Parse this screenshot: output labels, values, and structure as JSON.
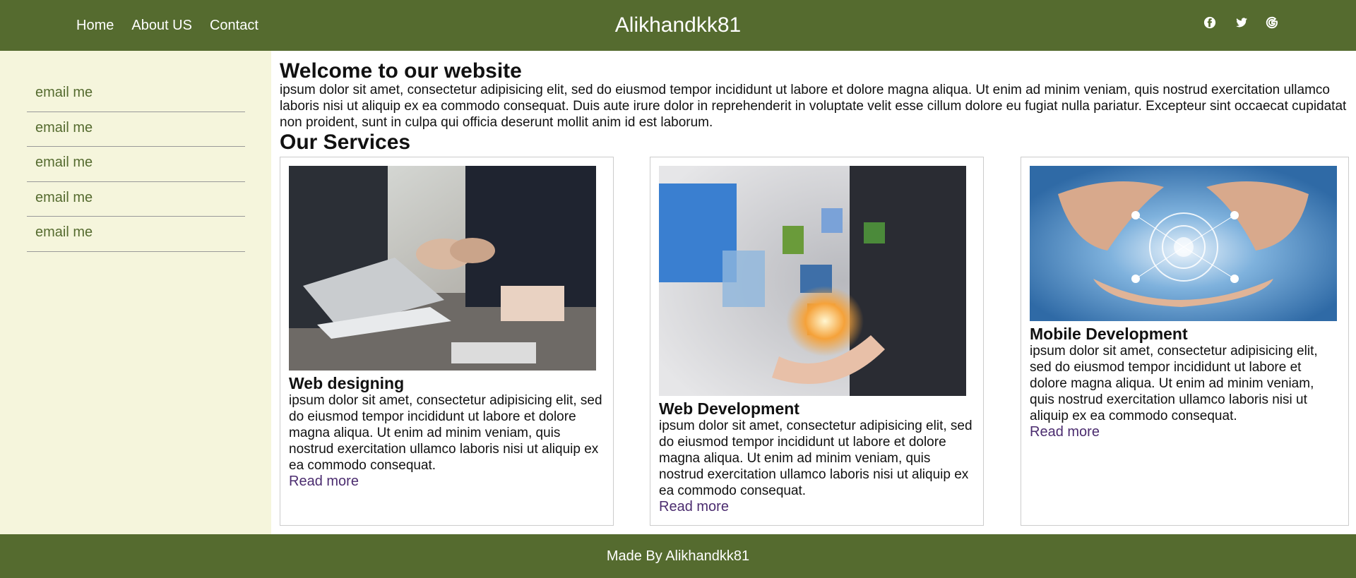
{
  "header": {
    "nav": [
      "Home",
      "About US",
      "Contact"
    ],
    "brand": "Alikhandkk81",
    "social_icons": [
      "facebook-icon",
      "twitter-icon",
      "google-icon"
    ]
  },
  "sidebar": {
    "items": [
      "email me",
      "email me",
      "email me",
      "email me",
      "email me"
    ]
  },
  "main": {
    "welcome_title": "Welcome to our website",
    "welcome_text": "ipsum dolor sit amet, consectetur adipisicing elit, sed do eiusmod tempor incididunt ut labore et dolore magna aliqua. Ut enim ad minim veniam, quis nostrud exercitation ullamco laboris nisi ut aliquip ex ea commodo consequat. Duis aute irure dolor in reprehenderit in voluptate velit esse cillum dolore eu fugiat nulla pariatur. Excepteur sint occaecat cupidatat non proident, sunt in culpa qui officia deserunt mollit anim id est laborum.",
    "services_title": "Our Services",
    "services": [
      {
        "title": "Web designing",
        "text": "ipsum dolor sit amet, consectetur adipisicing elit, sed do eiusmod tempor incididunt ut labore et dolore magna aliqua. Ut enim ad minim veniam, quis nostrud exercitation ullamco laboris nisi ut aliquip ex ea commodo consequat.",
        "link": "Read more",
        "image": "handshake-business-meeting-photo"
      },
      {
        "title": "Web Development",
        "text": "ipsum dolor sit amet, consectetur adipisicing elit, sed do eiusmod tempor incididunt ut labore et dolore magna aliqua. Ut enim ad minim veniam, quis nostrud exercitation ullamco laboris nisi ut aliquip ex ea commodo consequat.",
        "link": "Read more",
        "image": "floating-media-screens-photo"
      },
      {
        "title": "Mobile Development",
        "text": "ipsum dolor sit amet, consectetur adipisicing elit, sed do eiusmod tempor incididunt ut labore et dolore magna aliqua. Ut enim ad minim veniam, quis nostrud exercitation ullamco laboris nisi ut aliquip ex ea commodo consequat.",
        "link": "Read more",
        "image": "hands-holding-globe-network-photo"
      }
    ]
  },
  "footer": {
    "text": "Made By Alikhandkk81"
  },
  "colors": {
    "header_bg": "#556b2f",
    "sidebar_bg": "#f5f5dc",
    "sidebar_text": "#556b2f",
    "link": "#4b2c6f"
  }
}
